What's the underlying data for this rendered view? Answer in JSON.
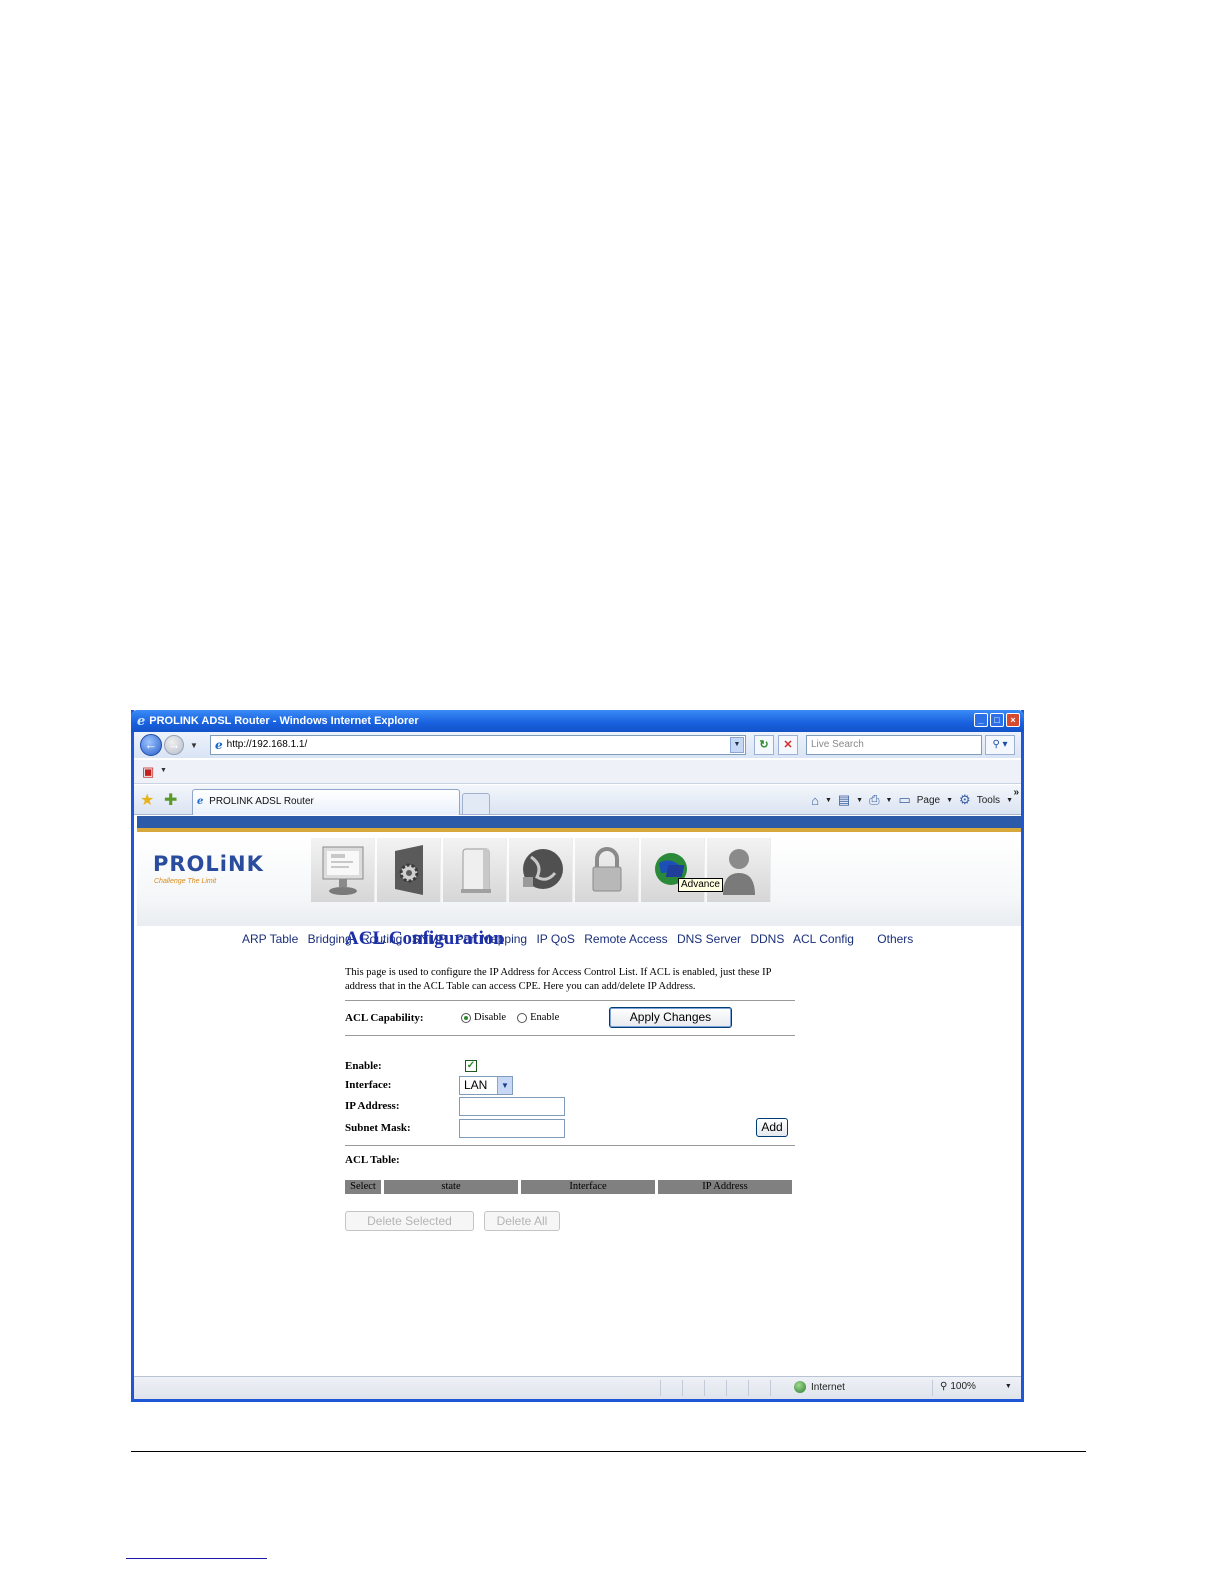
{
  "window": {
    "title": "PROLINK ADSL Router - Windows Internet Explorer",
    "icon": "ie-icon",
    "controls": [
      "minimize",
      "maximize",
      "close"
    ]
  },
  "navbar": {
    "address": "http://192.168.1.1/",
    "search_placeholder": "Live Search"
  },
  "tabs": [
    {
      "label": "PROLINK ADSL Router",
      "active": true
    }
  ],
  "command_bar": {
    "page_label": "Page",
    "tools_label": "Tools"
  },
  "router": {
    "logo": "PROLiNK",
    "logo_tagline": "Challenge The Limit",
    "tooltip": "Advance",
    "menu": [
      "ARP Table",
      "Bridging",
      "Routing",
      "SNMP",
      "Port Mapping",
      "IP QoS",
      "Remote Access",
      "DNS Server",
      "DDNS",
      "ACL Config"
    ],
    "menu_others": "Others",
    "accent_blue": "#2a5aa8",
    "accent_gold": "#d8a93a"
  },
  "acl": {
    "title": "ACL Configuration",
    "description": "This page is used to configure the IP Address for Access Control List. If ACL is enabled, just these IP address that in the ACL Table can access CPE. Here you can add/delete IP Address.",
    "capability_label": "ACL Capability:",
    "disable_label": "Disable",
    "enable_label": "Enable",
    "capability_value": "Disable",
    "apply_button": "Apply Changes",
    "enable_field_label": "Enable:",
    "enable_checked": true,
    "interface_label": "Interface:",
    "interface_value": "LAN",
    "ip_label": "IP Address:",
    "ip_value": "",
    "mask_label": "Subnet Mask:",
    "mask_value": "",
    "add_button": "Add",
    "table_label": "ACL Table:",
    "table_columns": [
      "Select",
      "state",
      "Interface",
      "IP Address"
    ],
    "delete_selected_button": "Delete Selected",
    "delete_all_button": "Delete All"
  },
  "status_bar": {
    "zone": "Internet",
    "zoom": "100%"
  }
}
